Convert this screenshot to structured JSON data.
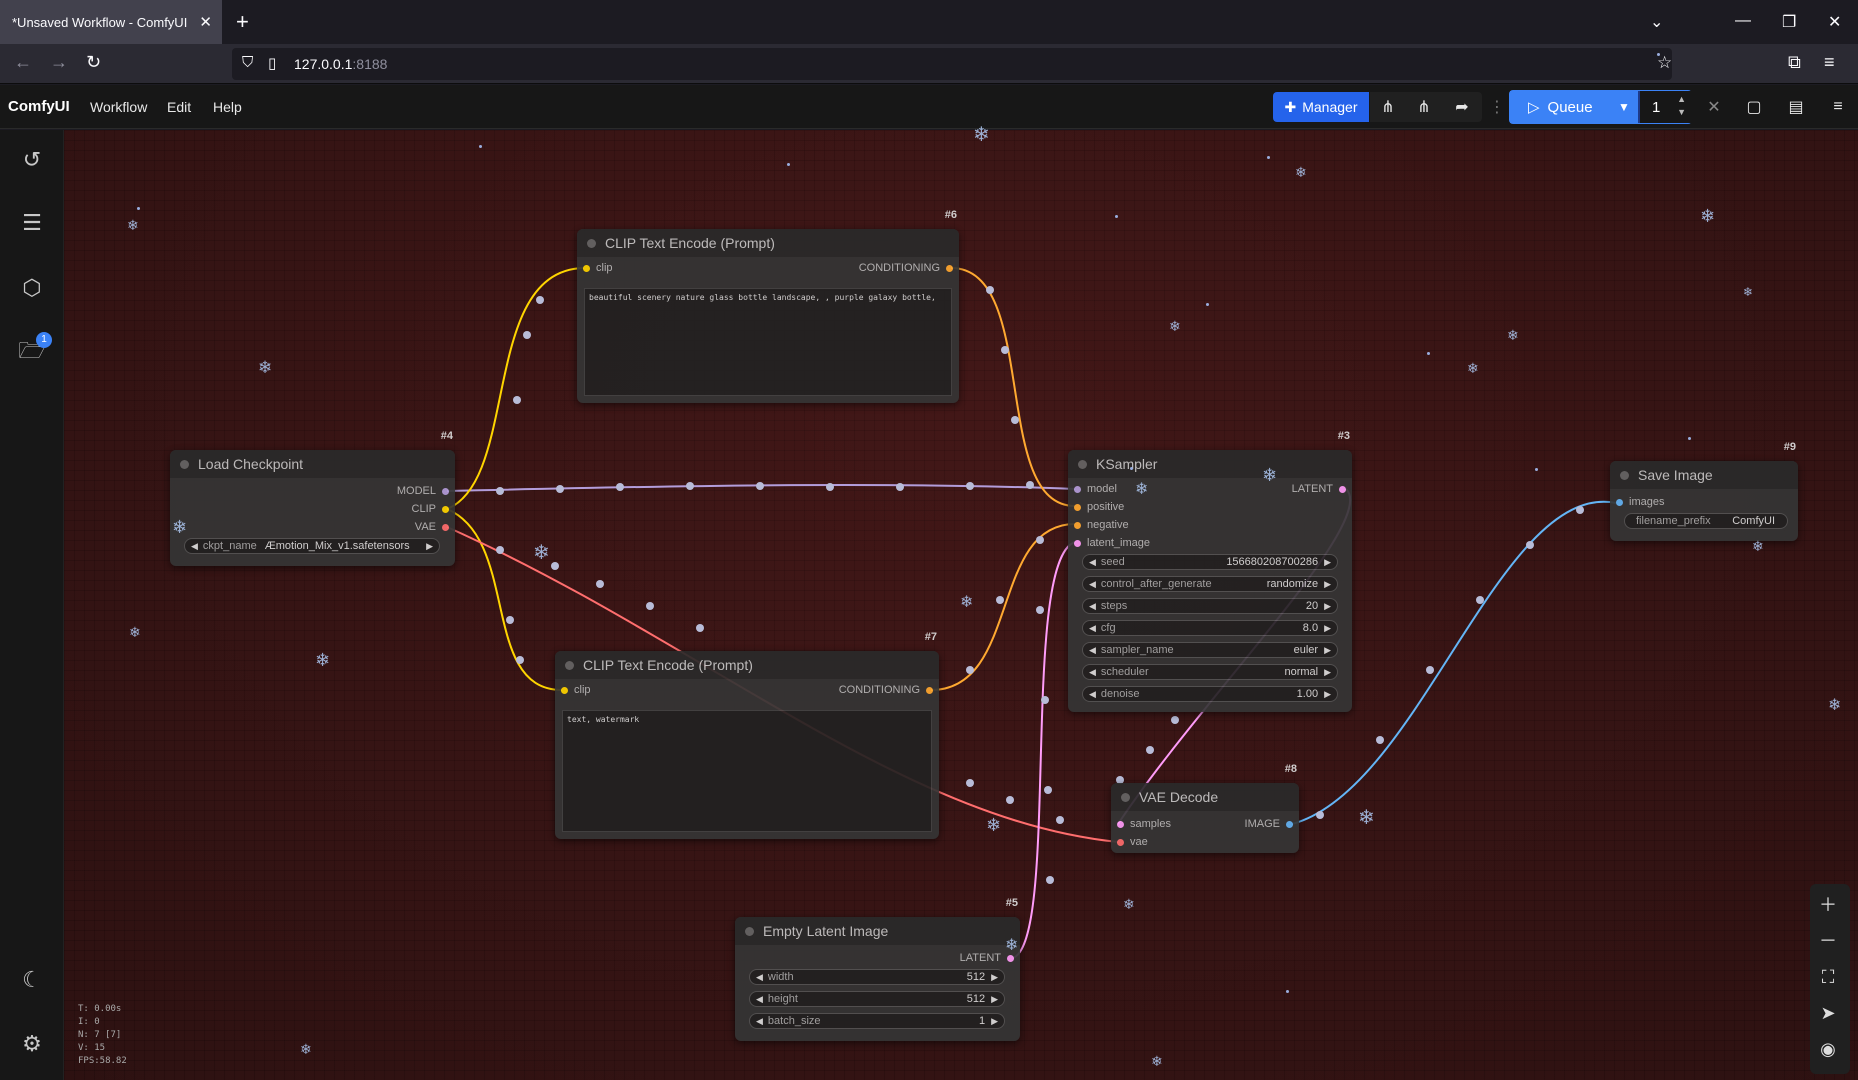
{
  "browser": {
    "tab_title": "*Unsaved Workflow - ComfyUI",
    "url_host": "127.0.0.1",
    "url_port": ":8188"
  },
  "menu": {
    "brand": "ComfyUI",
    "items": [
      "Workflow",
      "Edit",
      "Help"
    ],
    "manager_label": "Manager",
    "queue_label": "Queue",
    "queue_count": "1"
  },
  "sidebar": {
    "icons": [
      "history-icon",
      "node-library-icon",
      "model-library-icon",
      "workflows-icon",
      "theme-icon",
      "settings-icon"
    ],
    "workflows_badge": "1"
  },
  "nodes": {
    "clip_pos": {
      "id": "#6",
      "title": "CLIP Text Encode (Prompt)",
      "in_clip": "clip",
      "out_cond": "CONDITIONING",
      "text": "beautiful scenery nature glass bottle landscape, , purple galaxy bottle,"
    },
    "clip_neg": {
      "id": "#7",
      "title": "CLIP Text Encode (Prompt)",
      "in_clip": "clip",
      "out_cond": "CONDITIONING",
      "text": "text, watermark"
    },
    "checkpoint": {
      "id": "#4",
      "title": "Load Checkpoint",
      "out_model": "MODEL",
      "out_clip": "CLIP",
      "out_vae": "VAE",
      "ckpt_label": "ckpt_name",
      "ckpt_value": "Æmotion_Mix_v1.safetensors"
    },
    "ksampler": {
      "id": "#3",
      "title": "KSampler",
      "in_model": "model",
      "in_positive": "positive",
      "in_negative": "negative",
      "in_latent": "latent_image",
      "out_latent": "LATENT",
      "widgets": [
        {
          "label": "seed",
          "value": "156680208700286"
        },
        {
          "label": "control_after_generate",
          "value": "randomize"
        },
        {
          "label": "steps",
          "value": "20"
        },
        {
          "label": "cfg",
          "value": "8.0"
        },
        {
          "label": "sampler_name",
          "value": "euler"
        },
        {
          "label": "scheduler",
          "value": "normal"
        },
        {
          "label": "denoise",
          "value": "1.00"
        }
      ]
    },
    "save": {
      "id": "#9",
      "title": "Save Image",
      "in_images": "images",
      "prefix_label": "filename_prefix",
      "prefix_value": "ComfyUI"
    },
    "vae": {
      "id": "#8",
      "title": "VAE Decode",
      "in_samples": "samples",
      "in_vae": "vae",
      "out_image": "IMAGE"
    },
    "latent": {
      "id": "#5",
      "title": "Empty Latent Image",
      "out_latent": "LATENT",
      "widgets": [
        {
          "label": "width",
          "value": "512"
        },
        {
          "label": "height",
          "value": "512"
        },
        {
          "label": "batch_size",
          "value": "1"
        }
      ]
    }
  },
  "stats": [
    "T: 0.00s",
    "I: 0",
    "N: 7 [7]",
    "V: 15",
    "FPS:58.82"
  ],
  "colors": {
    "model": "#b39ddb",
    "clip": "#ffd500",
    "vae": "#ff6e6e",
    "conditioning": "#ffa931",
    "latent": "#ff9cf9",
    "image": "#64b5f6",
    "accent": "#3b82f6"
  }
}
